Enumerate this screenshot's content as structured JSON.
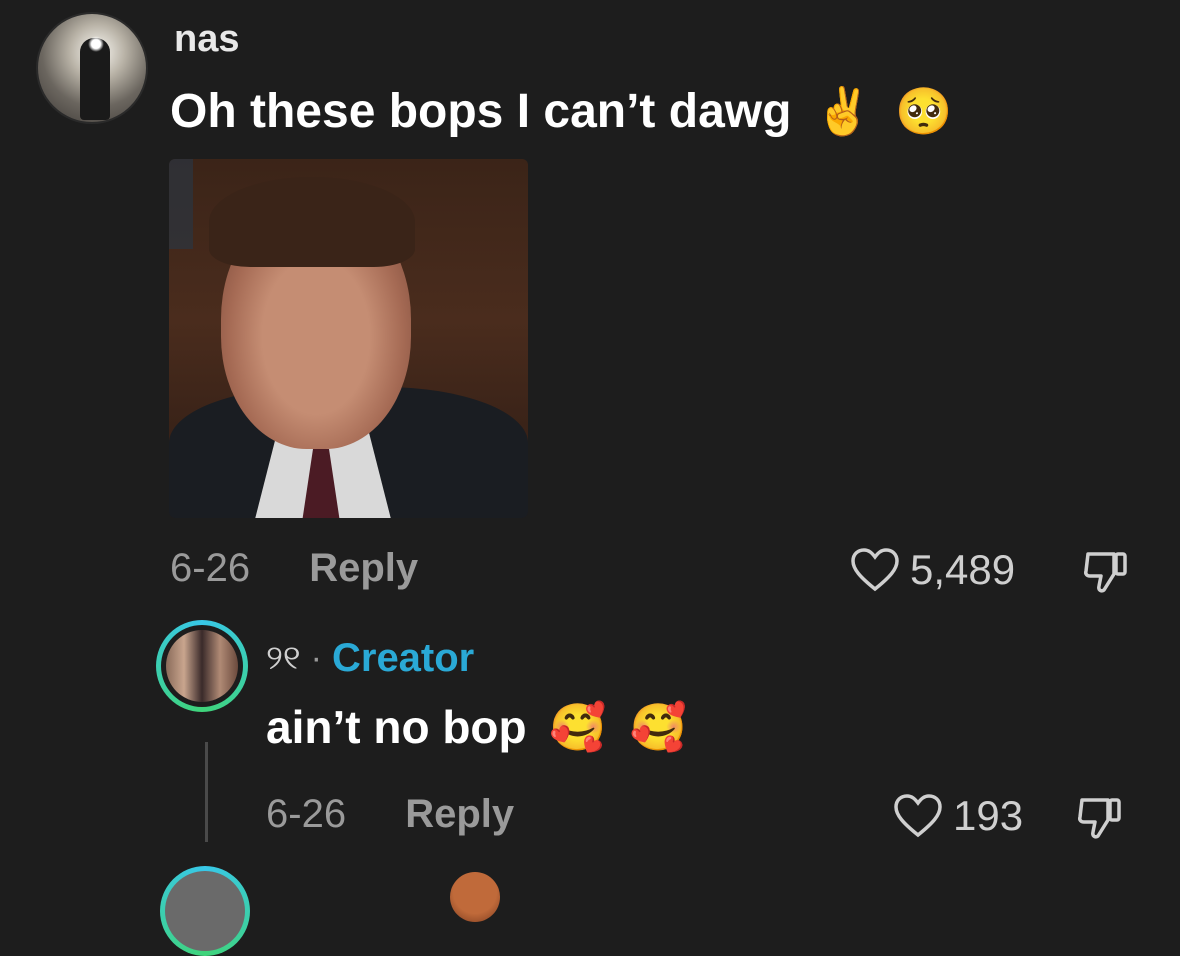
{
  "comment": {
    "username": "nas",
    "username_icon": "apple-icon",
    "text": "Oh these bops I can’t dawg",
    "emojis": [
      "✌️",
      "🥺"
    ],
    "date": "6-26",
    "reply_label": "Reply",
    "likes": "5,489"
  },
  "reply": {
    "username": "୨୧",
    "separator": "·",
    "badge": "Creator",
    "text": "ain’t no bop",
    "emojis": [
      "🥰",
      "🥰"
    ],
    "date": "6-26",
    "reply_label": "Reply",
    "likes": "193"
  },
  "colors": {
    "background": "#1d1d1d",
    "creator_badge": "#2aa9d6",
    "secondary_text": "#9a9a9a"
  }
}
